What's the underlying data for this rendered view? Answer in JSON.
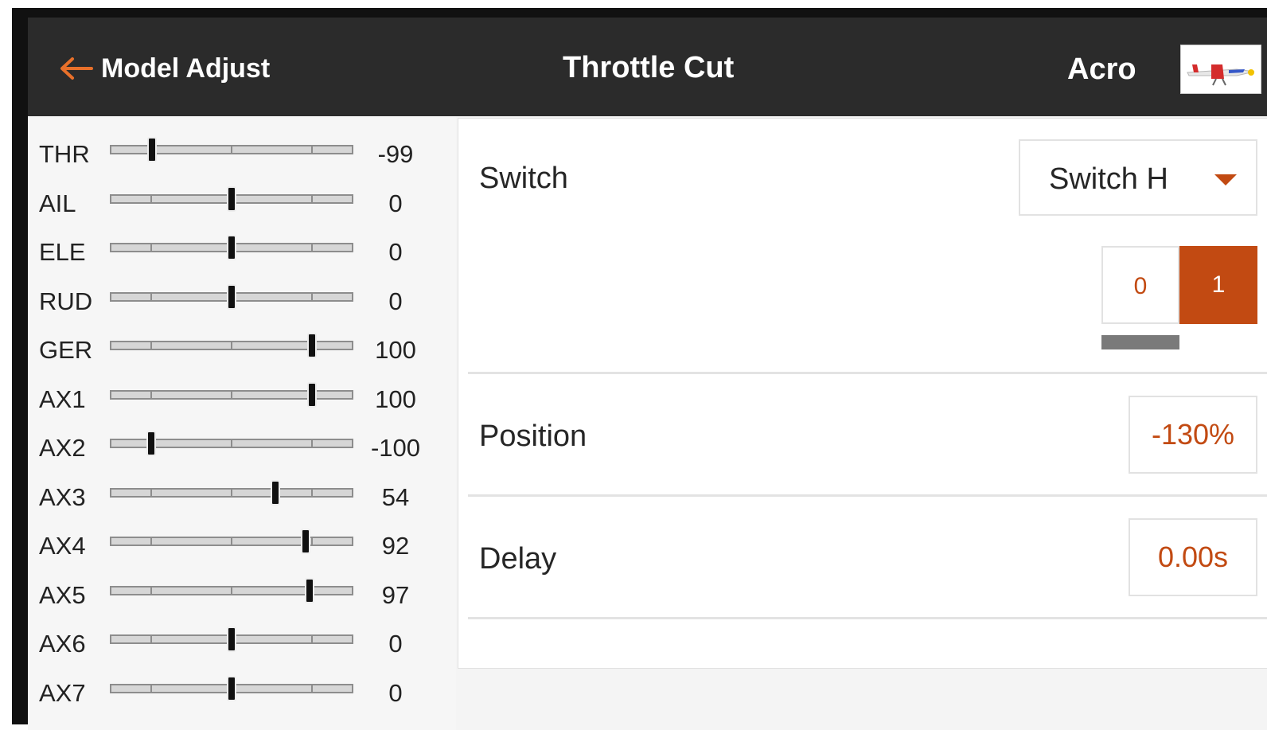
{
  "header": {
    "back_label": "Model Adjust",
    "title": "Throttle Cut",
    "model_name": "Acro",
    "accent_color": "#c24a12",
    "back_icon": "arrow-left-icon"
  },
  "channels": [
    {
      "label": "THR",
      "value": "-99"
    },
    {
      "label": "AIL",
      "value": "0"
    },
    {
      "label": "ELE",
      "value": "0"
    },
    {
      "label": "RUD",
      "value": "0"
    },
    {
      "label": "GER",
      "value": "100"
    },
    {
      "label": "AX1",
      "value": "100"
    },
    {
      "label": "AX2",
      "value": "-100"
    },
    {
      "label": "AX3",
      "value": "54"
    },
    {
      "label": "AX4",
      "value": "92"
    },
    {
      "label": "AX5",
      "value": "97"
    },
    {
      "label": "AX6",
      "value": "0"
    },
    {
      "label": "AX7",
      "value": "0"
    }
  ],
  "settings": {
    "switch_label": "Switch",
    "switch_value": "Switch H",
    "switch_positions": [
      "0",
      "1"
    ],
    "active_position": "1",
    "current_position": "0",
    "position_label": "Position",
    "position_value": "-130%",
    "delay_label": "Delay",
    "delay_value": "0.00s"
  }
}
